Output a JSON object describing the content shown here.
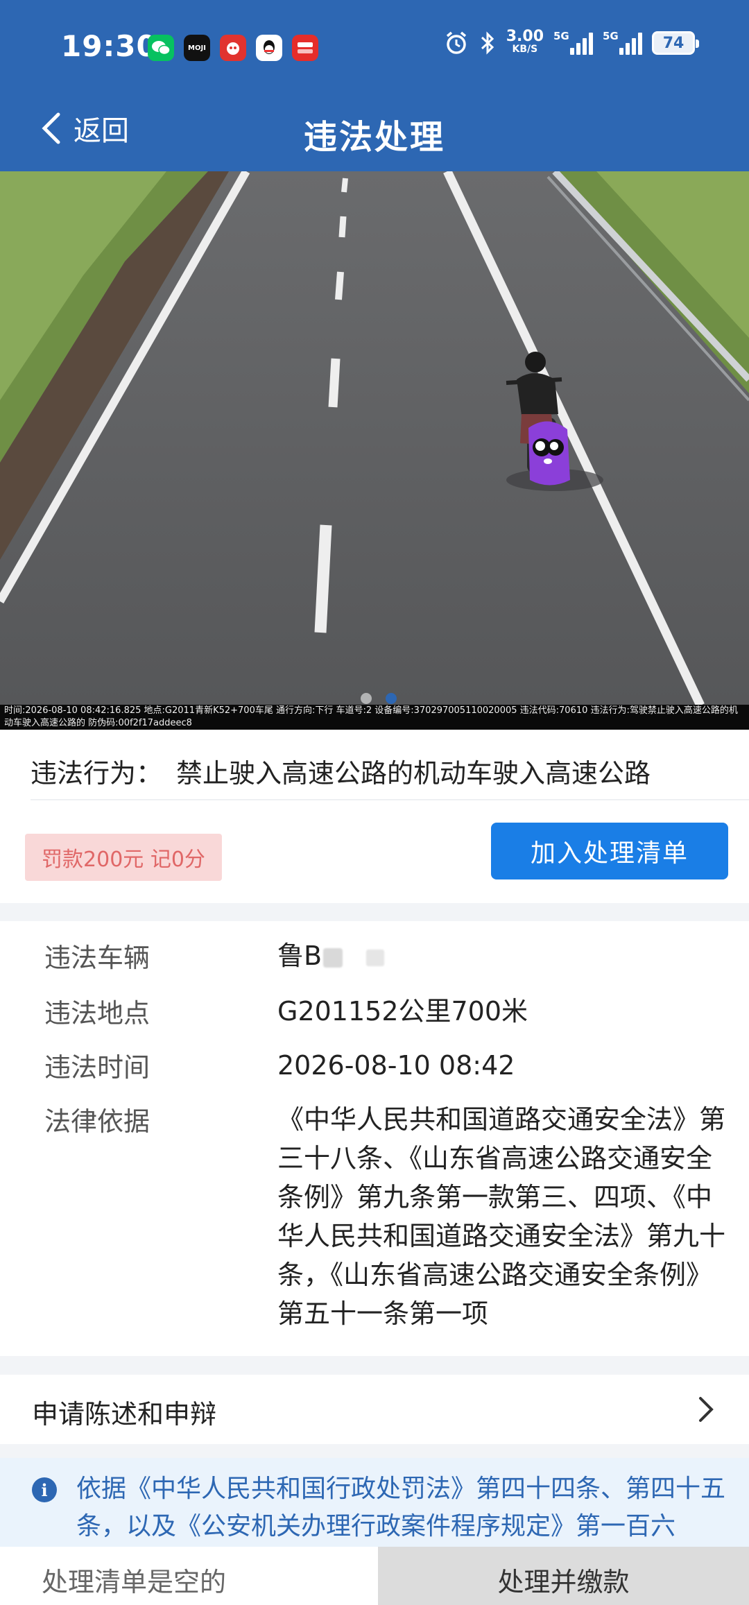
{
  "status_bar": {
    "time": "19:30",
    "app_icons": [
      "wechat-icon",
      "moji-icon",
      "red-app-icon",
      "qq-icon",
      "fan-app-icon"
    ],
    "app_icon_labels": {
      "moji": "MOJI"
    },
    "net_speed_value": "3.00",
    "net_speed_unit": "KB/S",
    "signal1_label": "5G",
    "signal2_label": "5G",
    "battery": "74"
  },
  "nav": {
    "back_label": "返回",
    "title": "违法处理"
  },
  "photo": {
    "caption": "时间:2026-08-10 08:42:16.825 地点:G2011青新K52+700车尾 通行方向:下行 车道号:2 设备编号:370297005110020005 违法代码:70610 违法行为:驾驶禁止驶入高速公路的机动车驶入高速公路的 防伪码:00f2f17addeec8",
    "slide_count": 2,
    "active_slide": 2
  },
  "violation": {
    "behavior_label": "违法行为：",
    "behavior_value": "禁止驶入高速公路的机动车驶入高速公路",
    "fine_badge": "罚款200元 记0分",
    "add_button": "加入处理清单"
  },
  "details": {
    "rows": [
      {
        "label": "违法车辆",
        "value": "鲁B"
      },
      {
        "label": "违法地点",
        "value": "G201152公里700米"
      },
      {
        "label": "违法时间",
        "value": "2026-08-10 08:42"
      },
      {
        "label": "法律依据",
        "value": "《中华人民共和国道路交通安全法》第三十八条、《山东省高速公路交通安全条例》第九条第一款第三、四项、《中华人民共和国道路交通安全法》第九十条，《山东省高速公路交通安全条例》第五十一条第一项"
      }
    ]
  },
  "appeal": {
    "label": "申请陈述和申辩"
  },
  "notice": {
    "text": "依据《中华人民共和国行政处罚法》第四十四条、第四十五条，以及《公安机关办理行政案件程序规定》第一百六"
  },
  "bottom_bar": {
    "cart_status": "处理清单是空的",
    "pay_button": "处理并缴款"
  },
  "colors": {
    "header": "#2d67b3",
    "primary_button": "#1a7ee6",
    "fine_badge_bg": "#f9d8d8",
    "fine_badge_text": "#e06767",
    "notice_bg": "#eaf3fc"
  }
}
